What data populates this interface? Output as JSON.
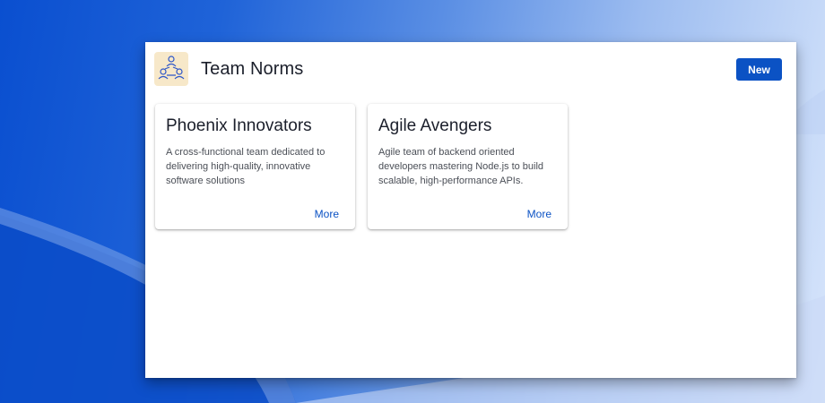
{
  "header": {
    "title": "Team Norms",
    "logo_icon": "team-network-icon",
    "new_button_label": "New"
  },
  "colors": {
    "accent": "#0b52c4",
    "logo_background": "#f7e8c9"
  },
  "teams": [
    {
      "name": "Phoenix Innovators",
      "description": "A cross-functional team dedicated to delivering high-quality, innovative software solutions",
      "more_label": "More"
    },
    {
      "name": "Agile Avengers",
      "description": "Agile team of backend oriented developers mastering Node.js to build scalable, high-performance APIs.",
      "more_label": "More"
    }
  ]
}
